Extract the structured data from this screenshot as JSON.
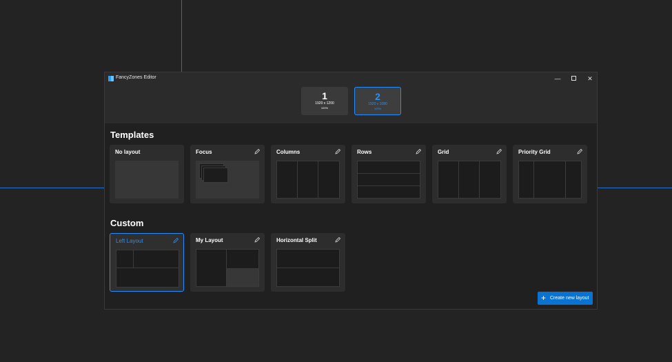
{
  "window": {
    "title": "FancyZones Editor",
    "min_glyph": "—",
    "close_glyph": "✕"
  },
  "monitors": [
    {
      "number": "1",
      "resolution": "1920 x 1200",
      "scale": "100%"
    },
    {
      "number": "2",
      "resolution": "1920 x 1080",
      "scale": "100%"
    }
  ],
  "sections": {
    "templates": "Templates",
    "custom": "Custom"
  },
  "templates": [
    {
      "label": "No layout"
    },
    {
      "label": "Focus"
    },
    {
      "label": "Columns"
    },
    {
      "label": "Rows"
    },
    {
      "label": "Grid"
    },
    {
      "label": "Priority Grid"
    }
  ],
  "custom": [
    {
      "label": "Left Layout"
    },
    {
      "label": "My Layout"
    },
    {
      "label": "Horizontal Split"
    }
  ],
  "create_button": {
    "label": "Create new layout",
    "icon": "+"
  },
  "colors": {
    "accent": "#0a73d1",
    "guide": "#1f6fd0",
    "background": "#232323"
  }
}
